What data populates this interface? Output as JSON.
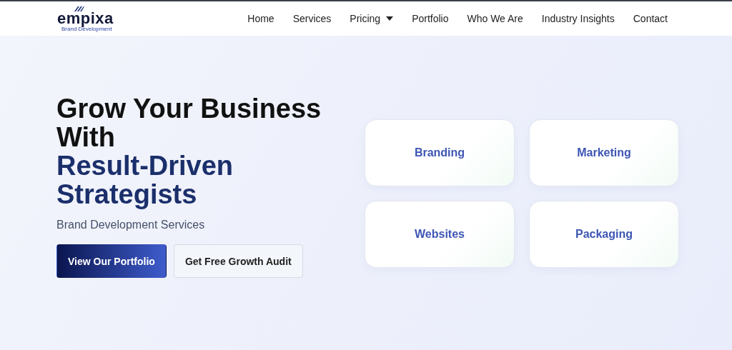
{
  "logo": {
    "name": "empixa",
    "tagline": "Brand Development"
  },
  "nav": [
    {
      "label": "Home",
      "dropdown": false
    },
    {
      "label": "Services",
      "dropdown": false
    },
    {
      "label": "Pricing",
      "dropdown": true
    },
    {
      "label": "Portfolio",
      "dropdown": false
    },
    {
      "label": "Who We Are",
      "dropdown": false
    },
    {
      "label": "Industry Insights",
      "dropdown": false
    },
    {
      "label": "Contact",
      "dropdown": false
    }
  ],
  "hero": {
    "headline": [
      {
        "text": "Grow Your Business",
        "kind": "plain"
      },
      {
        "text": "With",
        "kind": "plain"
      },
      {
        "text": "Result-Driven",
        "kind": "accent"
      },
      {
        "text": "Strategists",
        "kind": "accent"
      }
    ],
    "subtitle": "Brand Development Services",
    "buttons": [
      {
        "label": "View Our Portfolio",
        "kind": "primary"
      },
      {
        "label": "Get Free Growth Audit",
        "kind": "secondary"
      }
    ]
  },
  "services": [
    "Branding",
    "Marketing",
    "Websites",
    "Packaging"
  ]
}
